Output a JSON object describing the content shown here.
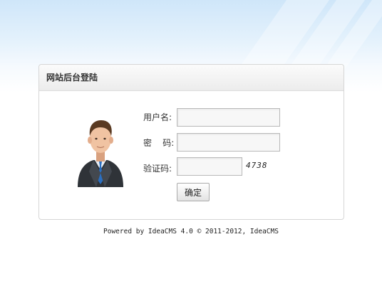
{
  "login_panel": {
    "title": "网站后台登陆",
    "fields": {
      "username_label": "用户名:",
      "username_value": "",
      "password_label": "密    码:",
      "password_value": "",
      "captcha_label": "验证码:",
      "captcha_value": "",
      "captcha_code": "4738"
    },
    "submit_label": "确定"
  },
  "footer": {
    "text": "Powered by IdeaCMS 4.0 © 2011-2012, IdeaCMS"
  },
  "colors": {
    "background_top": "#cfe6f9",
    "panel_border": "#d6d6d6",
    "header_bg": "#ececec",
    "input_border": "#b9b9b9"
  },
  "icons": {
    "avatar": "business-man-avatar-icon"
  }
}
